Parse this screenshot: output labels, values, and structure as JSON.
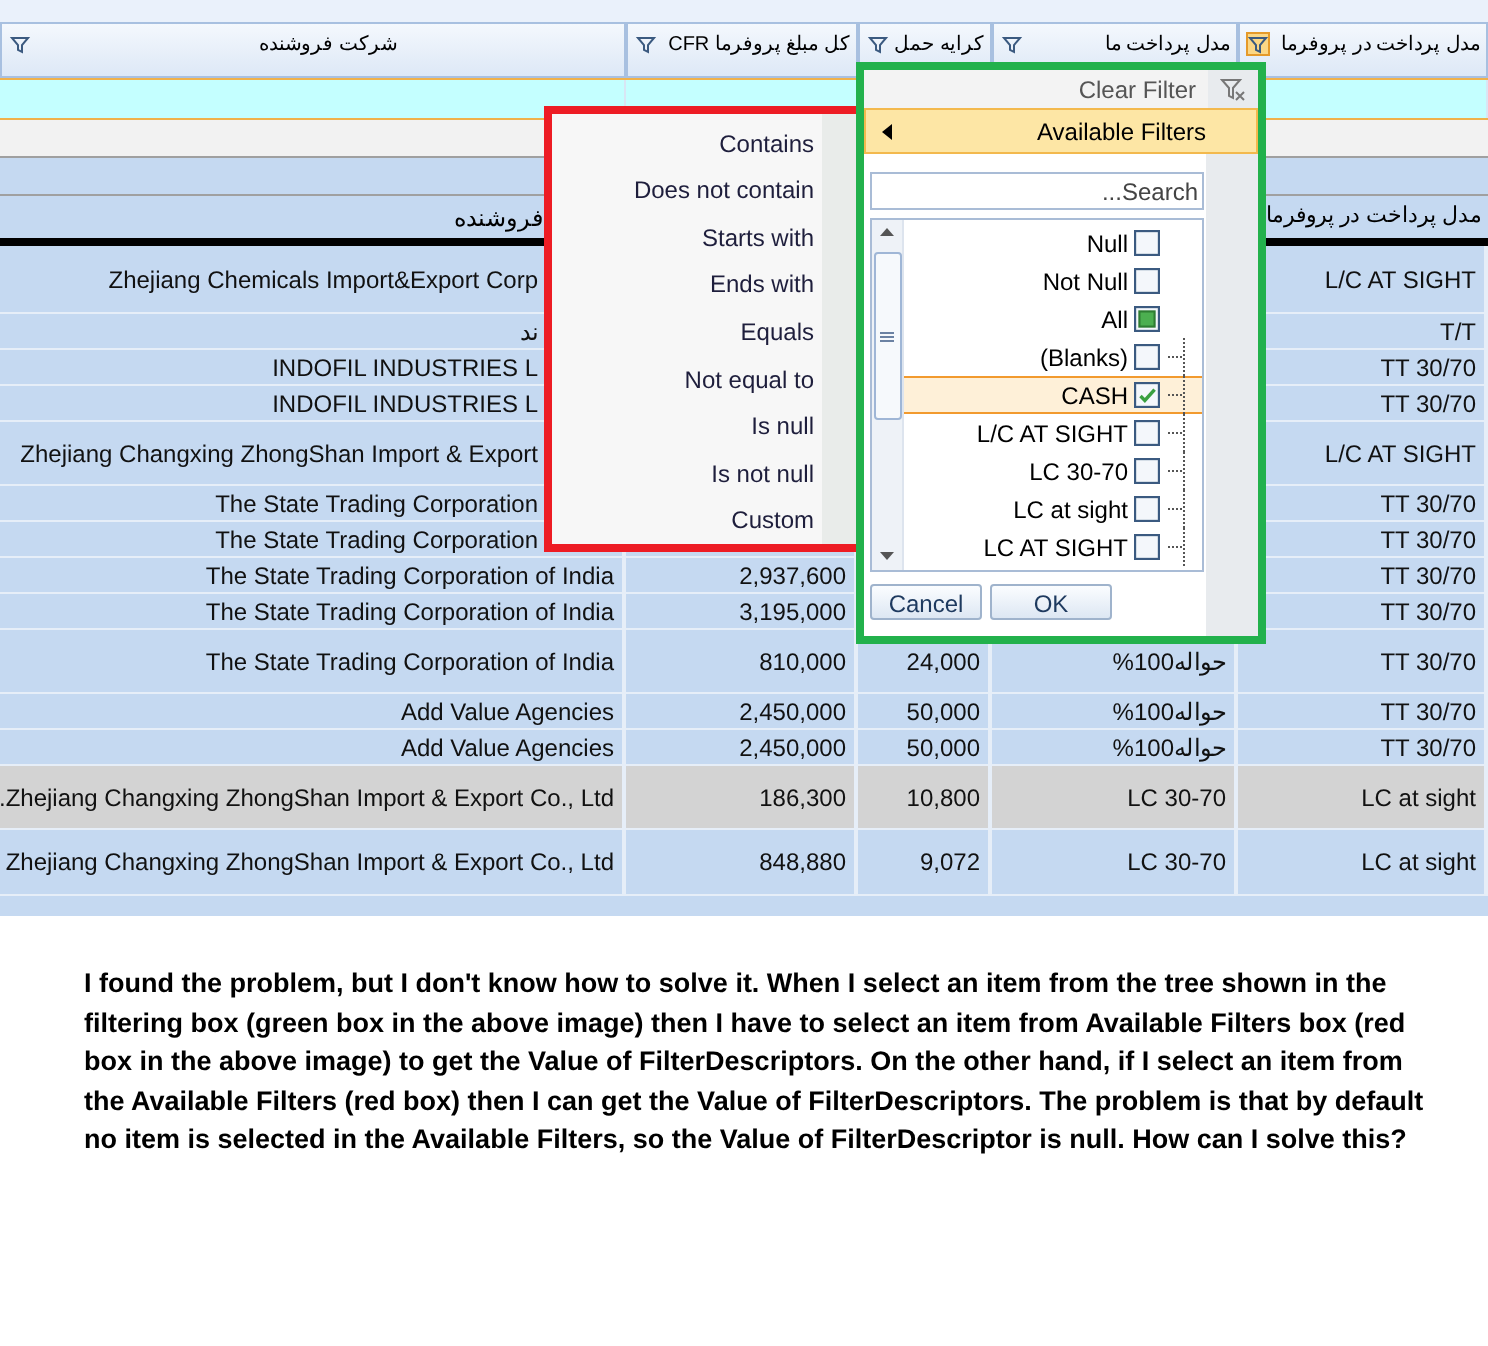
{
  "grid": {
    "columns": [
      {
        "label": "مدل پرداخت در پروفرما",
        "filter_active": true
      },
      {
        "label": "مدل پرداخت ما",
        "filter_active": false
      },
      {
        "label": "کرایه حمل",
        "filter_active": false
      },
      {
        "label": "کل مبلغ پروفرما CFR",
        "filter_active": false
      },
      {
        "label": "شرکت فروشنده",
        "filter_active": false
      }
    ],
    "group_row": {
      "seller": "فروشنده",
      "proforma_payment": "مدل پرداخت در پروفرما"
    },
    "rows": [
      {
        "seller": "Zhejiang Chemicals Import&Export Corp",
        "proforma_payment": "L/C AT SIGHT",
        "selected": false
      },
      {
        "seller": "ند",
        "proforma_payment": "T/T",
        "selected": false
      },
      {
        "seller": "INDOFIL INDUSTRIES L",
        "proforma_payment": "TT 30/70",
        "selected": false
      },
      {
        "seller": "INDOFIL INDUSTRIES L",
        "proforma_payment": "TT 30/70",
        "selected": false
      },
      {
        "seller": "Zhejiang Changxing ZhongShan Import & Export",
        "proforma_payment": "L/C AT SIGHT",
        "selected": false
      },
      {
        "seller": "The State Trading Corporation",
        "proforma_payment": "TT 30/70",
        "selected": false
      },
      {
        "seller": "The State Trading Corporation",
        "proforma_payment": "TT 30/70",
        "selected": false
      },
      {
        "seller": "The State Trading Corporation of India",
        "amount": "2,937,600",
        "proforma_payment": "TT 30/70",
        "selected": false
      },
      {
        "seller": "The State Trading Corporation of India",
        "amount": "3,195,000",
        "proforma_payment": "TT 30/70",
        "selected": false
      },
      {
        "seller": "The State Trading Corporation of India",
        "amount": "810,000",
        "freight": "24,000",
        "our_payment": "%100حواله",
        "proforma_payment": "TT 30/70",
        "selected": false
      },
      {
        "seller": "Add Value Agencies",
        "amount": "2,450,000",
        "freight": "50,000",
        "our_payment": "%100حواله",
        "proforma_payment": "TT 30/70",
        "selected": false
      },
      {
        "seller": "Add Value Agencies",
        "amount": "2,450,000",
        "freight": "50,000",
        "our_payment": "%100حواله",
        "proforma_payment": "TT 30/70",
        "selected": false
      },
      {
        "seller": ".Zhejiang Changxing ZhongShan Import & Export Co., Ltd",
        "amount": "186,300",
        "freight": "10,800",
        "our_payment": "LC 30-70",
        "proforma_payment": "LC at sight",
        "selected": true
      },
      {
        "seller": "Zhejiang Changxing ZhongShan Import & Export Co., Ltd",
        "amount": "848,880",
        "freight": "9,072",
        "our_payment": "LC 30-70",
        "proforma_payment": "LC at sight",
        "selected": false
      }
    ]
  },
  "operator_menu": {
    "items": [
      "Contains",
      "Does not contain",
      "Starts with",
      "Ends with",
      "Equals",
      "Not equal to",
      "Is null",
      "Is not null",
      "Custom"
    ]
  },
  "filter_panel": {
    "clear_filter": "Clear Filter",
    "available_filters": "Available Filters",
    "search": {
      "placeholder": "...Search"
    },
    "items": [
      {
        "label": "Null",
        "kind": "option",
        "checked": false,
        "indeterminate": false,
        "selected": false
      },
      {
        "label": "Not Null",
        "kind": "option",
        "checked": false,
        "indeterminate": false,
        "selected": false
      },
      {
        "label": "All",
        "kind": "option",
        "checked": false,
        "indeterminate": true,
        "selected": false
      },
      {
        "label": "(Blanks)",
        "kind": "value",
        "checked": false,
        "indeterminate": false,
        "selected": false
      },
      {
        "label": "CASH",
        "kind": "value",
        "checked": true,
        "indeterminate": false,
        "selected": true
      },
      {
        "label": "L/C AT SIGHT",
        "kind": "value",
        "checked": false,
        "indeterminate": false,
        "selected": false
      },
      {
        "label": "LC 30-70",
        "kind": "value",
        "checked": false,
        "indeterminate": false,
        "selected": false
      },
      {
        "label": "LC at sight",
        "kind": "value",
        "checked": false,
        "indeterminate": false,
        "selected": false
      },
      {
        "label": "LC AT SIGHT",
        "kind": "value",
        "checked": false,
        "indeterminate": false,
        "selected": false
      }
    ],
    "buttons": [
      "Cancel",
      "OK"
    ]
  },
  "question": "I found the problem, but I don't know how to solve it. When I select an item from the tree shown in the filtering box (green box in the above image) then I have to select an item from Available Filters box (red box in the above image) to get the Value of FilterDescriptors. On the other hand, if I select an item from the Available Filters (red box) then I can get the Value of FilterDescriptors. The problem is that by default no item is selected in the Available Filters, so the Value of FilterDescriptor is null. How can I solve this?"
}
